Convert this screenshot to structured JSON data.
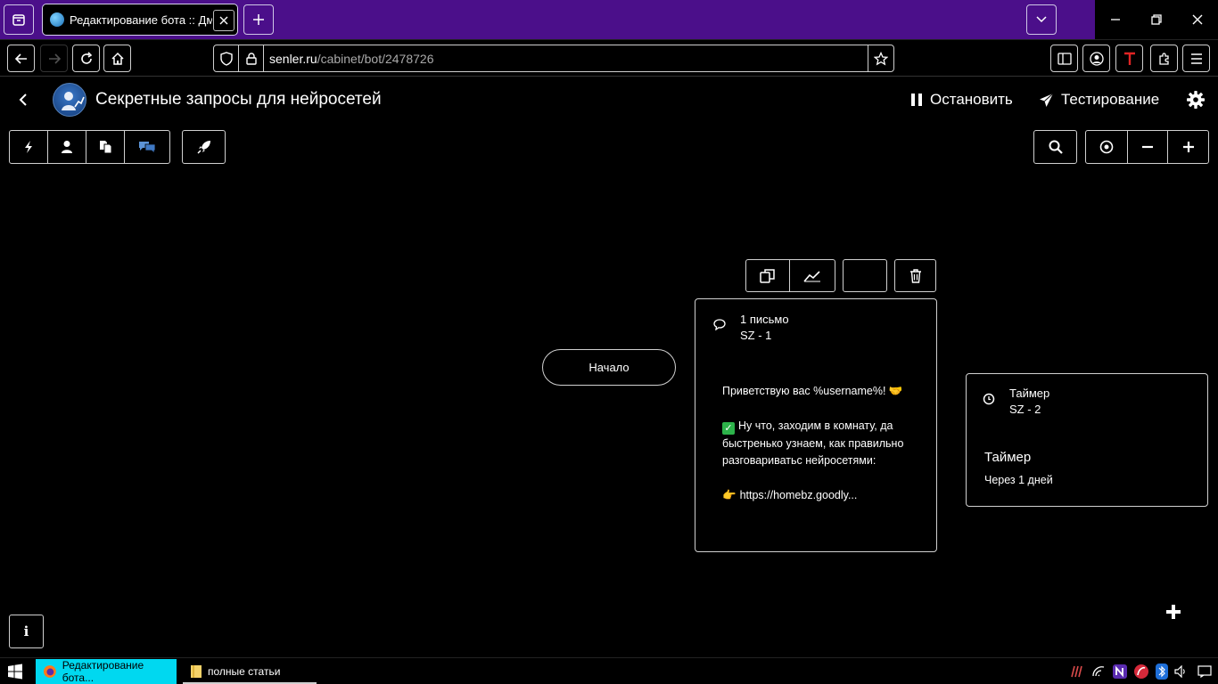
{
  "browser": {
    "tab_title": "Редактирование бота :: Дмитрий",
    "url_domain": "senler.ru",
    "url_path": "/cabinet/bot/2478726"
  },
  "app": {
    "bot_title": "Секретные запросы для нейросетей",
    "stop_label": "Остановить",
    "test_label": "Тестирование"
  },
  "canvas": {
    "start_node_label": "Начало",
    "message_node": {
      "type_label": "1 письмо",
      "step_label": "SZ - 1",
      "greeting": "Приветствую вас %username%! 🤝",
      "line1": "Ну что, заходим в комнату, да быстренько узнаем, как правильно разговариватьс нейросетями:",
      "link_line": "https://homebz.goodly..."
    },
    "timer_node": {
      "type_label": "Таймер",
      "step_label": "SZ - 2",
      "title": "Таймер",
      "subtitle": "Через 1 дней"
    }
  },
  "taskbar": {
    "task1": "Редактирование бота...",
    "task2": "полные статьи"
  },
  "colors": {
    "tab_strip": "#4b0f8a",
    "active_task": "#00d8f0",
    "background": "#000000"
  }
}
